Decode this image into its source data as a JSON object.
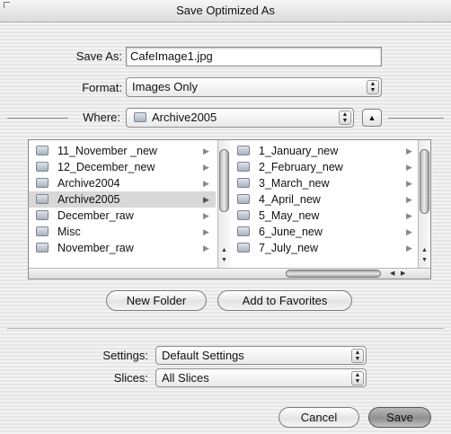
{
  "window": {
    "title": "Save Optimized As"
  },
  "save_as": {
    "label": "Save As:",
    "value": "CafeImage1.jpg"
  },
  "format": {
    "label": "Format:",
    "value": "Images Only"
  },
  "where": {
    "label": "Where:",
    "value": "Archive2005"
  },
  "browser": {
    "left_column": [
      {
        "name": "11_November _new",
        "selected": false
      },
      {
        "name": "12_December_new",
        "selected": false
      },
      {
        "name": "Archive2004",
        "selected": false
      },
      {
        "name": "Archive2005",
        "selected": true
      },
      {
        "name": "December_raw",
        "selected": false
      },
      {
        "name": "Misc",
        "selected": false
      },
      {
        "name": "November_raw",
        "selected": false
      }
    ],
    "right_column": [
      {
        "name": "1_January_new"
      },
      {
        "name": "2_February_new"
      },
      {
        "name": "3_March_new"
      },
      {
        "name": "4_April_new"
      },
      {
        "name": "5_May_new"
      },
      {
        "name": "6_June_new"
      },
      {
        "name": "7_July_new"
      }
    ]
  },
  "buttons": {
    "new_folder": "New Folder",
    "add_to_favorites": "Add to Favorites",
    "cancel": "Cancel",
    "save": "Save"
  },
  "settings": {
    "label": "Settings:",
    "value": "Default Settings"
  },
  "slices": {
    "label": "Slices:",
    "value": "All Slices"
  },
  "icons": {
    "folder": "folder-icon",
    "disclosure": "disclosure-triangle-icon",
    "popup_arrows": "up-down-arrows-icon",
    "up_button": "up-arrow-icon"
  }
}
